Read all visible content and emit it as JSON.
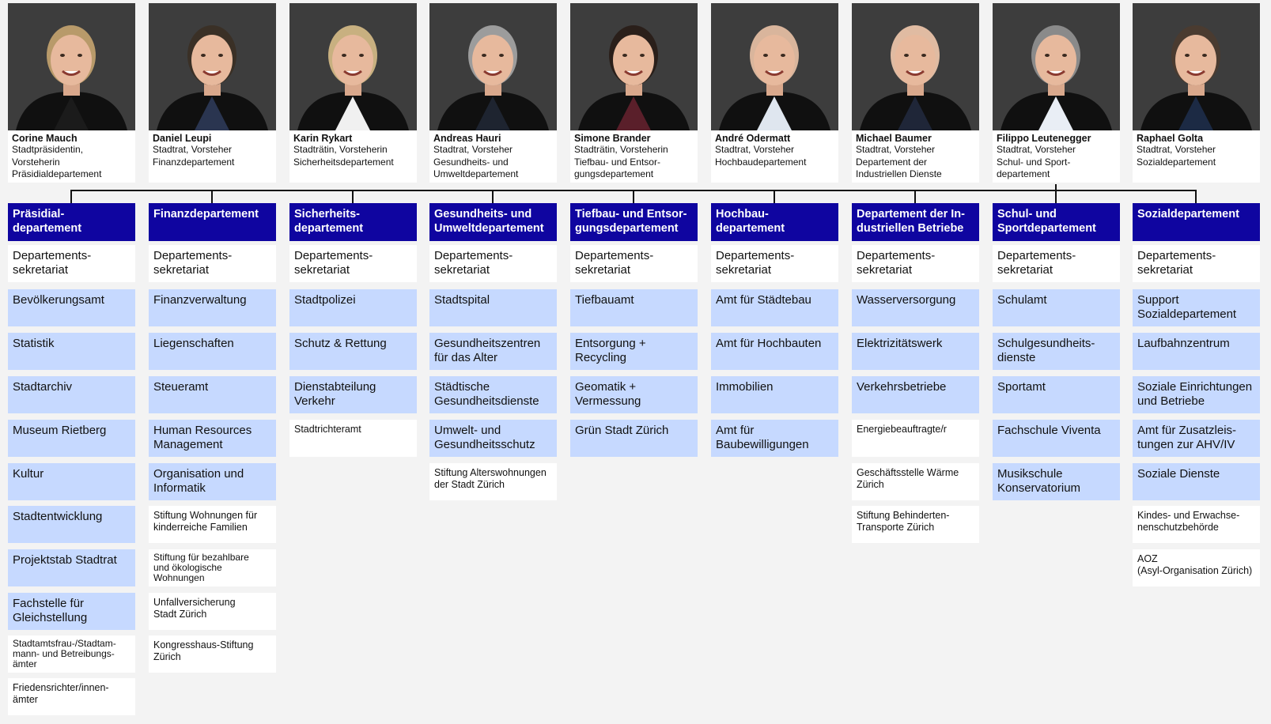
{
  "columns": [
    {
      "person_name": "Corine Mauch",
      "person_role": "Stadtpräsidentin,\nVorsteherin\nPräsidialdepartement",
      "dept": "Präsidial-\ndepartement",
      "units": [
        {
          "label": "Departements-\nsekretariat",
          "style": "sec"
        },
        {
          "label": "Bevölkerungsamt",
          "style": "blue"
        },
        {
          "label": "Statistik",
          "style": "blue"
        },
        {
          "label": "Stadtarchiv",
          "style": "blue"
        },
        {
          "label": "Museum Rietberg",
          "style": "blue"
        },
        {
          "label": "Kultur",
          "style": "blue"
        },
        {
          "label": "Stadtentwicklung",
          "style": "blue"
        },
        {
          "label": "Projektstab Stadtrat",
          "style": "blue"
        },
        {
          "label": "Fachstelle für\nGleichstellung",
          "style": "blue"
        },
        {
          "label": "Stadtamtsfrau-/Stadtam-\nmann- und Betreibungs-\nämter",
          "style": "tiny"
        },
        {
          "label": "Friedensrichter/innen-\nämter",
          "style": "small"
        }
      ]
    },
    {
      "person_name": "Daniel Leupi",
      "person_role": "Stadtrat, Vorsteher\nFinanzdepartement",
      "dept": "Finanzdepartement",
      "units": [
        {
          "label": "Departements-\nsekretariat",
          "style": "sec"
        },
        {
          "label": "Finanzverwaltung",
          "style": "blue"
        },
        {
          "label": "Liegenschaften",
          "style": "blue"
        },
        {
          "label": "Steueramt",
          "style": "blue"
        },
        {
          "label": "Human Resources\nManagement",
          "style": "blue"
        },
        {
          "label": "Organisation und\nInformatik",
          "style": "blue"
        },
        {
          "label": "Stiftung Wohnungen für\nkinderreiche Familien",
          "style": "small"
        },
        {
          "label": "Stiftung für bezahlbare\nund ökologische\nWohnungen",
          "style": "tiny"
        },
        {
          "label": "Unfallversicherung\nStadt Zürich",
          "style": "small"
        },
        {
          "label": "Kongresshaus-Stiftung\nZürich",
          "style": "small"
        }
      ]
    },
    {
      "person_name": "Karin Rykart",
      "person_role": "Stadträtin, Vorsteherin\nSicherheitsdepartement",
      "dept": "Sicherheits-\ndepartement",
      "units": [
        {
          "label": "Departements-\nsekretariat",
          "style": "sec"
        },
        {
          "label": "Stadtpolizei",
          "style": "blue"
        },
        {
          "label": "Schutz & Rettung",
          "style": "blue"
        },
        {
          "label": "Dienstabteilung\nVerkehr",
          "style": "blue"
        },
        {
          "label": "Stadtrichteramt",
          "style": "small"
        }
      ]
    },
    {
      "person_name": "Andreas Hauri",
      "person_role": "Stadtrat, Vorsteher\nGesundheits- und\nUmweltdepartement",
      "dept": "Gesundheits- und\nUmweltdepartement",
      "units": [
        {
          "label": "Departements-\nsekretariat",
          "style": "sec"
        },
        {
          "label": "Stadtspital",
          "style": "blue"
        },
        {
          "label": "Gesundheitszentren\nfür das Alter",
          "style": "blue"
        },
        {
          "label": "Städtische\nGesundheitsdienste",
          "style": "blue"
        },
        {
          "label": "Umwelt- und\nGesundheitsschutz",
          "style": "blue"
        },
        {
          "label": "Stiftung Alterswohnungen\nder Stadt Zürich",
          "style": "small"
        }
      ]
    },
    {
      "person_name": "Simone Brander",
      "person_role": "Stadträtin, Vorsteherin\nTiefbau- und Entsor-\ngungsdepartement",
      "dept": "Tiefbau- und Entsor-\ngungsdepartement",
      "units": [
        {
          "label": "Departements-\nsekretariat",
          "style": "sec"
        },
        {
          "label": "Tiefbauamt",
          "style": "blue"
        },
        {
          "label": "Entsorgung +\nRecycling",
          "style": "blue"
        },
        {
          "label": "Geomatik +\nVermessung",
          "style": "blue"
        },
        {
          "label": "Grün Stadt Zürich",
          "style": "blue"
        }
      ]
    },
    {
      "person_name": "André Odermatt",
      "person_role": "Stadtrat, Vorsteher\nHochbaudepartement",
      "dept": "Hochbau-\ndepartement",
      "units": [
        {
          "label": "Departements-\nsekretariat",
          "style": "sec"
        },
        {
          "label": "Amt für Städtebau",
          "style": "blue"
        },
        {
          "label": "Amt für Hochbauten",
          "style": "blue"
        },
        {
          "label": "Immobilien",
          "style": "blue"
        },
        {
          "label": "Amt für\nBaubewilligungen",
          "style": "blue"
        }
      ]
    },
    {
      "person_name": "Michael Baumer",
      "person_role": "Stadtrat, Vorsteher\nDepartement der\nIndustriellen Dienste",
      "dept": "Departement der In-\ndustriellen Betriebe",
      "units": [
        {
          "label": "Departements-\nsekretariat",
          "style": "sec"
        },
        {
          "label": "Wasserversorgung",
          "style": "blue"
        },
        {
          "label": "Elektrizitätswerk",
          "style": "blue"
        },
        {
          "label": "Verkehrsbetriebe",
          "style": "blue"
        },
        {
          "label": "Energiebeauftragte/r",
          "style": "small"
        },
        {
          "label": "Geschäftsstelle Wärme\nZürich",
          "style": "small"
        },
        {
          "label": "Stiftung Behinderten-\nTransporte Zürich",
          "style": "small"
        }
      ]
    },
    {
      "person_name": "Filippo Leutenegger",
      "person_role": "Stadtrat, Vorsteher\nSchul- und Sport-\ndepartement",
      "dept": "Schul- und\nSportdepartement",
      "units": [
        {
          "label": "Departements-\nsekretariat",
          "style": "sec"
        },
        {
          "label": "Schulamt",
          "style": "blue"
        },
        {
          "label": "Schulgesundheits-\ndienste",
          "style": "blue"
        },
        {
          "label": "Sportamt",
          "style": "blue"
        },
        {
          "label": "Fachschule Viventa",
          "style": "blue"
        },
        {
          "label": "Musikschule\nKonservatorium",
          "style": "blue"
        }
      ]
    },
    {
      "person_name": "Raphael Golta",
      "person_role": "Stadtrat, Vorsteher\nSozialdepartement",
      "dept": "Sozialdepartement",
      "units": [
        {
          "label": "Departements-\nsekretariat",
          "style": "sec"
        },
        {
          "label": "Support\nSozialdepartement",
          "style": "blue"
        },
        {
          "label": "Laufbahnzentrum",
          "style": "blue"
        },
        {
          "label": "Soziale Einrichtungen\nund Betriebe",
          "style": "blue"
        },
        {
          "label": "Amt für Zusatzleis-\ntungen zur AHV/IV",
          "style": "blue"
        },
        {
          "label": "Soziale Dienste",
          "style": "blue"
        },
        {
          "label": "Kindes- und Erwachse-\nnenschutzbehörde",
          "style": "small"
        },
        {
          "label": "AOZ\n(Asyl-Organisation Zürich)",
          "style": "small"
        }
      ]
    }
  ],
  "colors": {
    "dept_header": "#0f05a0",
    "unit_blue": "#c6d9ff",
    "unit_white": "#ffffff",
    "background": "#f3f3f3"
  }
}
